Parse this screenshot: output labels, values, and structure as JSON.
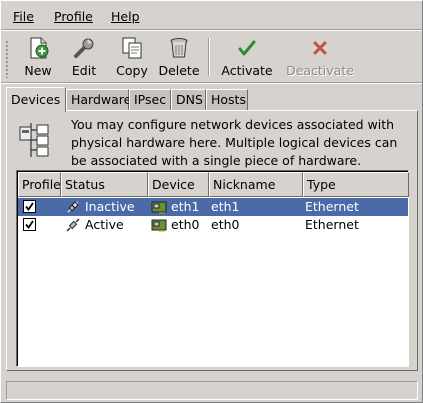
{
  "menubar": {
    "file": "File",
    "profile": "Profile",
    "help": "Help"
  },
  "toolbar": {
    "new": "New",
    "edit": "Edit",
    "copy": "Copy",
    "delete": "Delete",
    "activate": "Activate",
    "deactivate": "Deactivate"
  },
  "tabs": [
    "Devices",
    "Hardware",
    "IPsec",
    "DNS",
    "Hosts"
  ],
  "info_text": "You may configure network devices associated with physical hardware here.  Multiple logical devices can be associated with a single piece of hardware.",
  "table": {
    "headers": [
      "Profile",
      "Status",
      "Device",
      "Nickname",
      "Type"
    ],
    "rows": [
      {
        "profile_checked": true,
        "status": "Inactive",
        "device": "eth1",
        "nickname": "eth1",
        "type": "Ethernet",
        "selected": true
      },
      {
        "profile_checked": true,
        "status": "Active",
        "device": "eth0",
        "nickname": "eth0",
        "type": "Ethernet",
        "selected": false
      }
    ]
  },
  "colors": {
    "window_bg": "#d6d3ce",
    "selection": "#4b6aa8",
    "activate_green": "#2e8b2e",
    "deactivate_red": "#c0504d"
  },
  "icons": {
    "new": "new-document-plus-icon",
    "edit": "wrench-icon",
    "copy": "copy-documents-icon",
    "delete": "trash-can-icon",
    "activate": "check-mark-icon",
    "deactivate": "x-mark-icon",
    "info": "network-hardware-icon",
    "status_inactive": "unplugged-connector-icon",
    "status_active": "plugged-connector-icon",
    "device": "network-card-icon"
  }
}
